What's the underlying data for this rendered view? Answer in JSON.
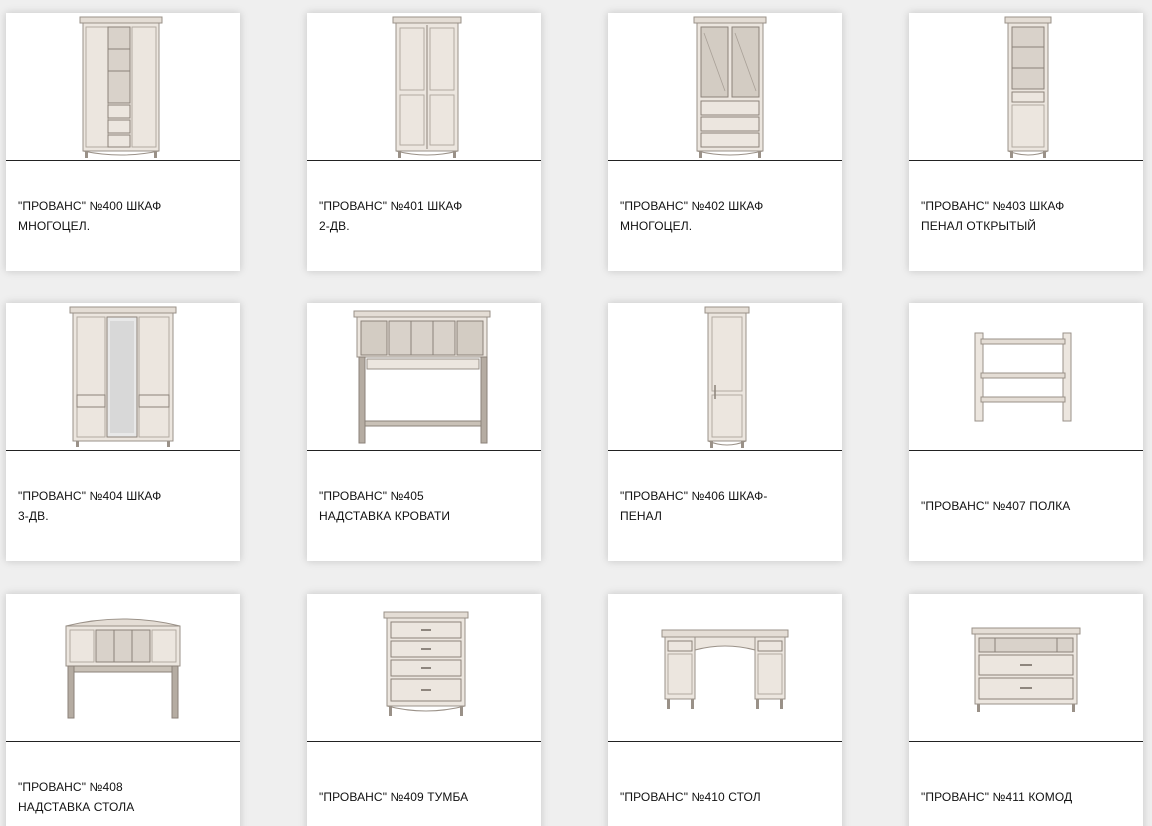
{
  "products": [
    {
      "name_line1": "\"ПРОВАНС\" №400 ШКАФ",
      "name_line2": "МНОГОЦЕЛ.",
      "image_icon": "wardrobe-multipurpose-icon"
    },
    {
      "name_line1": "\"ПРОВАНС\" №401 ШКАФ",
      "name_line2": "2-ДВ.",
      "image_icon": "wardrobe-2-door-icon"
    },
    {
      "name_line1": "\"ПРОВАНС\" №402 ШКАФ",
      "name_line2": "МНОГОЦЕЛ.",
      "image_icon": "glass-cabinet-drawers-icon"
    },
    {
      "name_line1": "\"ПРОВАНС\" №403 ШКАФ",
      "name_line2": "ПЕНАЛ ОТКРЫТЫЙ",
      "image_icon": "open-tall-cabinet-icon"
    },
    {
      "name_line1": "\"ПРОВАНС\" №404 ШКАФ",
      "name_line2": "3-ДВ.",
      "image_icon": "wardrobe-3-door-mirror-icon"
    },
    {
      "name_line1": "\"ПРОВАНС\" №405",
      "name_line2": "НАДСТАВКА КРОВАТИ",
      "image_icon": "bed-hutch-icon"
    },
    {
      "name_line1": "\"ПРОВАНС\" №406 ШКАФ-",
      "name_line2": "ПЕНАЛ",
      "image_icon": "narrow-tall-cabinet-icon"
    },
    {
      "name_line1": "\"ПРОВАНС\" №407 ПОЛКА",
      "name_line2": "",
      "image_icon": "wall-shelf-icon"
    },
    {
      "name_line1": "\"ПРОВАНС\" №408",
      "name_line2": "НАДСТАВКА СТОЛА",
      "image_icon": "desk-hutch-icon"
    },
    {
      "name_line1": "\"ПРОВАНС\" №409 ТУМБА",
      "name_line2": "",
      "image_icon": "chest-of-drawers-icon"
    },
    {
      "name_line1": "\"ПРОВАНС\" №410 СТОЛ",
      "name_line2": "",
      "image_icon": "writing-desk-icon"
    },
    {
      "name_line1": "\"ПРОВАНС\" №411 КОМОД",
      "name_line2": "",
      "image_icon": "commode-icon"
    }
  ],
  "colors": {
    "furniture": "#ece6df",
    "furniture_edge": "#9a9188",
    "divider": "#222222"
  }
}
